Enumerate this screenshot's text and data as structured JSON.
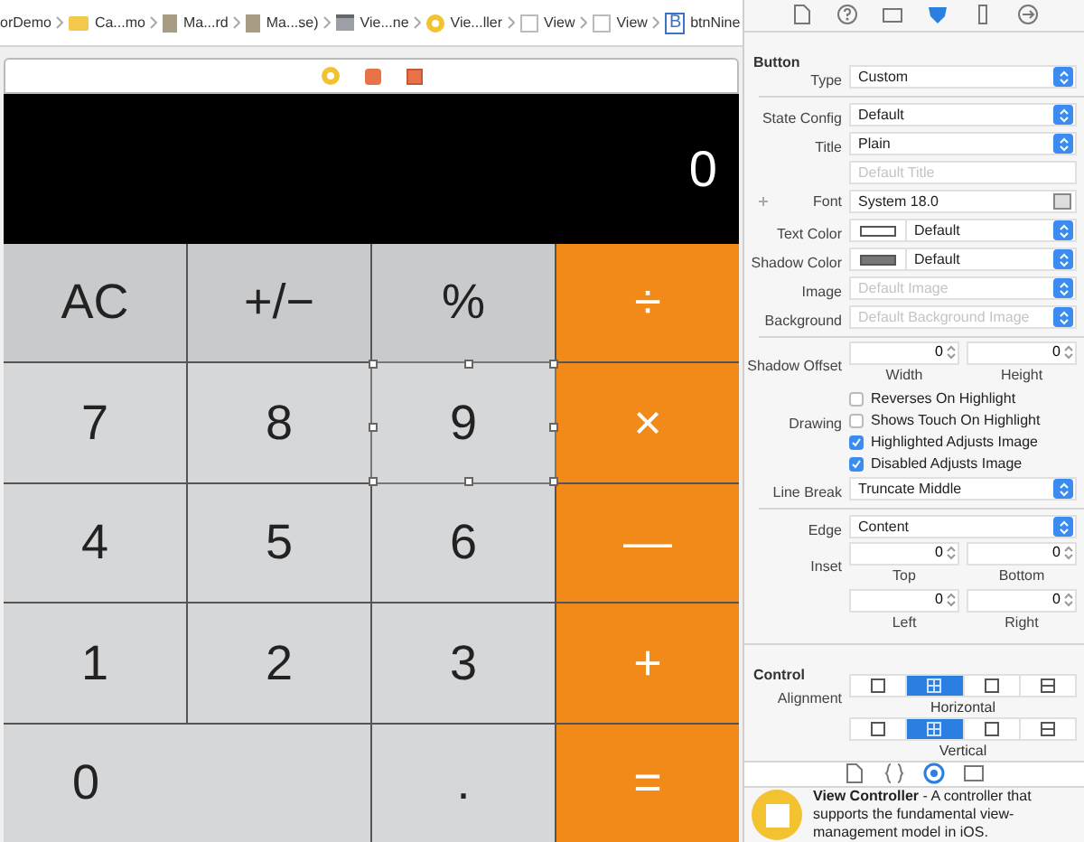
{
  "breadcrumb": [
    {
      "label": "orDemo",
      "kind": "none"
    },
    {
      "label": "Ca...mo",
      "kind": "folder"
    },
    {
      "label": "Ma...rd",
      "kind": "file"
    },
    {
      "label": "Ma...se)",
      "kind": "file"
    },
    {
      "label": "Vie...ne",
      "kind": "scene"
    },
    {
      "label": "Vie...ller",
      "kind": "controller"
    },
    {
      "label": "View",
      "kind": "view"
    },
    {
      "label": "View",
      "kind": "view"
    },
    {
      "label": "btnNine",
      "kind": "button",
      "glyph": "B"
    }
  ],
  "display": {
    "value": "0"
  },
  "keys": [
    {
      "label": "AC",
      "kind": "function",
      "selected": false
    },
    {
      "label": "+/−",
      "kind": "function",
      "selected": false
    },
    {
      "label": "%",
      "kind": "function",
      "selected": false
    },
    {
      "label": "÷",
      "kind": "operator",
      "selected": false
    },
    {
      "label": "7",
      "kind": "digit",
      "selected": false
    },
    {
      "label": "8",
      "kind": "digit",
      "selected": false
    },
    {
      "label": "9",
      "kind": "digit",
      "selected": true
    },
    {
      "label": "×",
      "kind": "operator",
      "selected": false
    },
    {
      "label": "4",
      "kind": "digit",
      "selected": false
    },
    {
      "label": "5",
      "kind": "digit",
      "selected": false
    },
    {
      "label": "6",
      "kind": "digit",
      "selected": false
    },
    {
      "label": "—",
      "kind": "operator",
      "selected": false
    },
    {
      "label": "1",
      "kind": "digit",
      "selected": false
    },
    {
      "label": "2",
      "kind": "digit",
      "selected": false
    },
    {
      "label": "3",
      "kind": "digit",
      "selected": false
    },
    {
      "label": "+",
      "kind": "operator",
      "selected": false
    },
    {
      "label": "0",
      "kind": "wide",
      "selected": false
    },
    {
      "label": ".",
      "kind": "digit",
      "selected": false
    },
    {
      "label": "=",
      "kind": "operator",
      "selected": false
    }
  ],
  "inspector_tabs": [
    {
      "kind": "file",
      "selected": false
    },
    {
      "kind": "help",
      "selected": false
    },
    {
      "kind": "identity",
      "selected": false
    },
    {
      "kind": "attributes",
      "selected": true
    },
    {
      "kind": "size",
      "selected": false
    },
    {
      "kind": "connections",
      "selected": false
    }
  ],
  "button_section": {
    "title": "Button",
    "rows": [
      {
        "kind": "select",
        "label": "Type",
        "value": "Custom"
      },
      {
        "kind": "divider"
      },
      {
        "kind": "select",
        "label": "State Config",
        "value": "Default"
      },
      {
        "kind": "select",
        "label": "Title",
        "value": "Plain"
      },
      {
        "kind": "text",
        "placeholder": "Default Title"
      },
      {
        "kind": "font",
        "label": "Font",
        "value": "System 18.0"
      },
      {
        "kind": "color",
        "label": "Text Color",
        "value": "Default",
        "color": "#ffffff"
      },
      {
        "kind": "color",
        "label": "Shadow Color",
        "value": "Default",
        "color": "#777777"
      },
      {
        "kind": "select",
        "label": "Image",
        "placeholder": "Default Image"
      },
      {
        "kind": "select",
        "label": "Background",
        "placeholder": "Default Background Image"
      },
      {
        "kind": "divider"
      },
      {
        "kind": "steppers",
        "label": "Shadow Offset",
        "fields": [
          {
            "value": "0",
            "caption": "Width"
          },
          {
            "value": "0",
            "caption": "Height"
          }
        ]
      },
      {
        "kind": "check",
        "label": "",
        "text": "Reverses On Highlight",
        "checked": false
      },
      {
        "kind": "check",
        "label": "Drawing",
        "text": "Shows Touch On Highlight",
        "checked": false
      },
      {
        "kind": "check",
        "label": "",
        "text": "Highlighted Adjusts Image",
        "checked": true
      },
      {
        "kind": "check",
        "label": "",
        "text": "Disabled Adjusts Image",
        "checked": true
      },
      {
        "kind": "select",
        "label": "Line Break",
        "value": "Truncate Middle"
      },
      {
        "kind": "divider"
      },
      {
        "kind": "select",
        "label": "Edge",
        "value": "Content"
      },
      {
        "kind": "steppers",
        "label": "Inset",
        "fields": [
          {
            "value": "0",
            "caption": "Top"
          },
          {
            "value": "0",
            "caption": "Bottom"
          }
        ]
      },
      {
        "kind": "steppers",
        "label": "",
        "fields": [
          {
            "value": "0",
            "caption": "Left"
          },
          {
            "value": "0",
            "caption": "Right"
          }
        ]
      }
    ]
  },
  "control_section": {
    "title": "Control",
    "label": "Alignment",
    "groups": [
      {
        "caption": "Horizontal",
        "segments": [
          {
            "kind": "left",
            "selected": false
          },
          {
            "kind": "center",
            "selected": true
          },
          {
            "kind": "right",
            "selected": false
          },
          {
            "kind": "fill",
            "selected": false
          }
        ]
      },
      {
        "caption": "Vertical",
        "segments": [
          {
            "kind": "top",
            "selected": false
          },
          {
            "kind": "center",
            "selected": true
          },
          {
            "kind": "bottom",
            "selected": false
          },
          {
            "kind": "fill",
            "selected": false
          }
        ]
      }
    ]
  },
  "library_tabs": [
    {
      "kind": "file",
      "selected": false
    },
    {
      "kind": "braces",
      "selected": false
    },
    {
      "kind": "object",
      "selected": true
    },
    {
      "kind": "media",
      "selected": false
    }
  ],
  "library_item": {
    "text": "**View Controller** - A controller that supports the fundamental view-management model in iOS."
  }
}
